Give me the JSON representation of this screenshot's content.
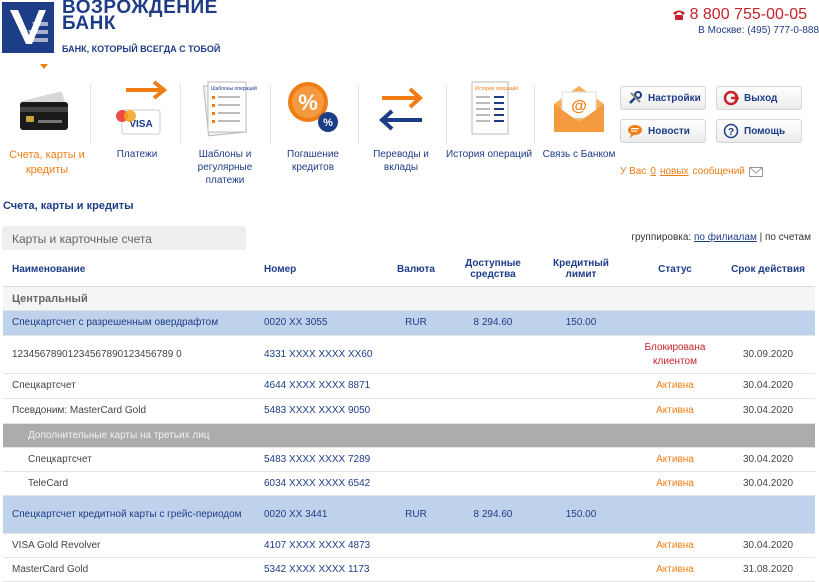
{
  "header": {
    "logo_title": "ВОЗРОЖДЕНИЕ БАНК",
    "slogan": "БАНК, КОТОРЫЙ ВСЕГДА С ТОБОЙ",
    "phone": "8 800 755-00-05",
    "phone_moscow": "В Москве: (495) 777-0-888"
  },
  "nav": [
    {
      "label": "Счета, карты и кредиты",
      "icon": "cards-icon"
    },
    {
      "label": "Платежи",
      "icon": "payment-arrow-icon"
    },
    {
      "label": "Шаблоны и регулярные платежи",
      "icon": "templates-icon"
    },
    {
      "label": "Погашение кредитов",
      "icon": "percent-icon"
    },
    {
      "label": "Переводы и вклады",
      "icon": "transfer-arrows-icon"
    },
    {
      "label": "История операций",
      "icon": "history-icon"
    },
    {
      "label": "Связь с Банком",
      "icon": "mail-icon"
    }
  ],
  "nav_icon_texts": {
    "visa": "VISA",
    "templates": "Шаблоны операций",
    "history": "История операций"
  },
  "buttons": {
    "settings": "Настройки",
    "logout": "Выход",
    "news": "Новости",
    "help": "Помощь"
  },
  "messages": {
    "prefix": "У Вас",
    "count": "0",
    "link": "новых",
    "suffix": "сообщений"
  },
  "section": {
    "breadcrumb": "Счета, карты и кредиты",
    "tab": "Карты и карточные счета",
    "grouping_label": "группировка:",
    "grouping_branch": "по филиалам",
    "grouping_sep": "|",
    "grouping_accounts": "по счетам"
  },
  "table": {
    "headers": {
      "name": "Наименование",
      "number": "Номер",
      "currency": "Валюта",
      "available": "Доступные средства",
      "limit": "Кредитный лимит",
      "status": "Статус",
      "expiry": "Срок действия"
    },
    "group": "Центральный",
    "extra_header": "Дополнительные карты на третьих лиц",
    "rows": [
      {
        "name": "Спецкартсчет с разрешенным овердрафтом",
        "number": "0020 XX 3055",
        "currency": "RUR",
        "available": "8 294.60",
        "limit": "150.00",
        "status": "",
        "expiry": ""
      },
      {
        "name": "12345678901234567890123456789 0",
        "number": "4331 XXXX XXXX XX60",
        "currency": "",
        "available": "",
        "limit": "",
        "status": "Блокирована клиентом",
        "expiry": "30.09.2020"
      },
      {
        "name": "Спецкартсчет",
        "number": "4644 XXXX XXXX 8871",
        "currency": "",
        "available": "",
        "limit": "",
        "status": "Активна",
        "expiry": "30.04.2020"
      },
      {
        "name": "Псевдоним: MasterCard Gold",
        "number": "5483 XXXX XXXX 9050",
        "currency": "",
        "available": "",
        "limit": "",
        "status": "Активна",
        "expiry": "30.04.2020"
      },
      {
        "name": "Спецкартсчет",
        "number": "5483 XXXX XXXX 7289",
        "currency": "",
        "available": "",
        "limit": "",
        "status": "Активна",
        "expiry": "30.04.2020"
      },
      {
        "name": "TeleCard",
        "number": "6034 XXXX XXXX 6542",
        "currency": "",
        "available": "",
        "limit": "",
        "status": "Активна",
        "expiry": "30.04.2020"
      },
      {
        "name": "Спецкартсчет кредитной карты с грейс-периодом",
        "number": "0020 XX 3441",
        "currency": "RUR",
        "available": "8 294.60",
        "limit": "150.00",
        "status": "",
        "expiry": ""
      },
      {
        "name": "VISA Gold Revolver",
        "number": "4107 XXXX XXXX 4873",
        "currency": "",
        "available": "",
        "limit": "",
        "status": "Активна",
        "expiry": "30.04.2020"
      },
      {
        "name": "MasterCard Gold",
        "number": "5342 XXXX XXXX 1173",
        "currency": "",
        "available": "",
        "limit": "",
        "status": "Активна",
        "expiry": "31.08.2020"
      }
    ]
  },
  "colors": {
    "brand_blue": "#1e3d87",
    "accent_orange": "#f07d14",
    "alert_red": "#c8232c",
    "row_highlight": "#bfd2ec"
  }
}
